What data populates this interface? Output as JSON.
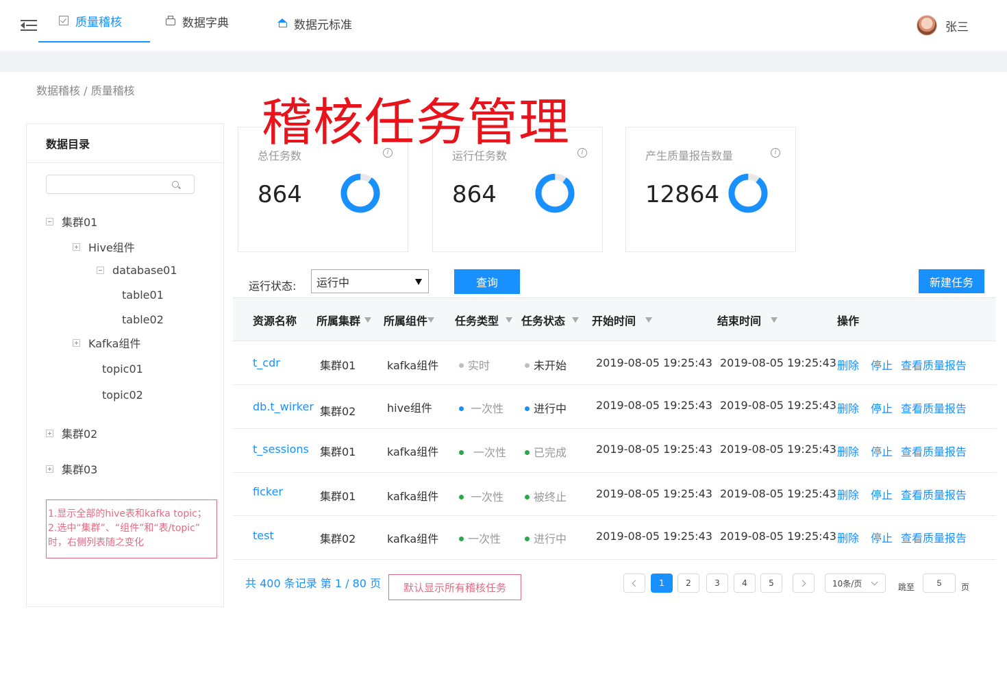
{
  "nav": {
    "tabs": [
      {
        "label": "质量稽核",
        "icon": "checkbox-icon",
        "active": true
      },
      {
        "label": "数据字典",
        "icon": "printer-icon",
        "active": false
      },
      {
        "label": "数据元标准",
        "icon": "home-icon",
        "active": false
      }
    ],
    "user": {
      "name": "张三"
    }
  },
  "breadcrumb": "数据稽核 / 质量稽核",
  "page_title": "稽核任务管理",
  "sidebar": {
    "title": "数据目录",
    "search_placeholder": "",
    "tree": [
      {
        "label": "集群01",
        "expander": "minus"
      },
      {
        "label": "Hive组件",
        "expander": "plus"
      },
      {
        "label": "database01",
        "expander": "minus"
      },
      {
        "label": "table01",
        "expander": "none"
      },
      {
        "label": "table02",
        "expander": "none"
      },
      {
        "label": "Kafka组件",
        "expander": "plus"
      },
      {
        "label": "topic01",
        "expander": "none"
      },
      {
        "label": "topic02",
        "expander": "none"
      },
      {
        "label": "集群02",
        "expander": "plus"
      },
      {
        "label": "集群03",
        "expander": "plus"
      }
    ],
    "note": {
      "line1": "1.显示全部的hive表和kafka topic；",
      "line2": "2.选中“集群”、“组件”和“表/topic”",
      "line3": "时，右侧列表随之变化"
    }
  },
  "stats": [
    {
      "label": "总任务数",
      "value": "864",
      "ratio": 0.9
    },
    {
      "label": "运行任务数",
      "value": "864",
      "ratio": 0.9
    },
    {
      "label": "产生质量报告数量",
      "value": "12864",
      "ratio": 0.9
    }
  ],
  "filter": {
    "status_label": "运行状态:",
    "status_value": "运行中",
    "query_button": "查询",
    "new_task_button": "新建任务"
  },
  "table": {
    "columns": [
      "资源名称",
      "所属集群",
      "所属组件",
      "任务类型",
      "任务状态",
      "开始时间",
      "结束时间",
      "操作"
    ],
    "rows": [
      {
        "name": "t_cdr",
        "cluster": "集群01",
        "component": "kafka组件",
        "type": "实时",
        "type_color": "#bfbfbf",
        "status": "未开始",
        "status_color": "#bfbfbf",
        "start": "2019-08-05 19:25:43",
        "end": "2019-08-05 19:25:43"
      },
      {
        "name": "db.t_wirker",
        "cluster": "集群02",
        "component": "hive组件",
        "type": "一次性",
        "type_color": "#1890ff",
        "status": "进行中",
        "status_color": "#1890ff",
        "start": "2019-08-05 19:25:43",
        "end": "2019-08-05 19:25:43"
      },
      {
        "name": "t_sessions",
        "cluster": "集群01",
        "component": "kafka组件",
        "type": "一次性",
        "type_color": "#2aa84a",
        "status": "已完成",
        "status_color": "#2aa84a",
        "start": "2019-08-05 19:25:43",
        "end": "2019-08-05 19:25:43"
      },
      {
        "name": "ficker",
        "cluster": "集群01",
        "component": "kafka组件",
        "type": "一次性",
        "type_color": "#2aa84a",
        "status": "被终止",
        "status_color": "#2aa84a",
        "start": "2019-08-05 19:25:43",
        "end": "2019-08-05 19:25:43"
      },
      {
        "name": "test",
        "cluster": "集群02",
        "component": "kafka组件",
        "type": "一次性",
        "type_color": "#2aa84a",
        "status": "进行中",
        "status_color": "#2aa84a",
        "start": "2019-08-05 19:25:43",
        "end": "2019-08-05 19:25:43"
      }
    ],
    "actions": {
      "delete": "删除",
      "stop": "停止",
      "report": "查看质量报告"
    }
  },
  "pagination": {
    "summary": "共 400 条记录 第 1 / 80 页",
    "default_button": "默认显示所有稽核任务",
    "pages": [
      "1",
      "2",
      "3",
      "4",
      "5"
    ],
    "current": "1",
    "page_size": "10条/页",
    "jump_label": "跳至",
    "jump_value": "5",
    "page_suffix": "页"
  },
  "colors": {
    "primary": "#1890ff",
    "title_red": "#e8141c",
    "note_pink": "#e46b82",
    "success": "#2aa84a",
    "muted": "#bfbfbf"
  }
}
